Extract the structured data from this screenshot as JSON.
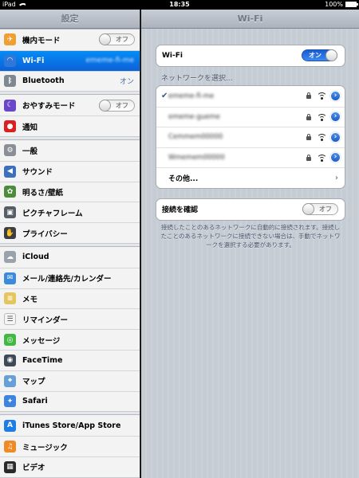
{
  "status_bar": {
    "carrier": "iPad",
    "time": "18:35",
    "battery": "100%"
  },
  "sidebar": {
    "title": "設定",
    "groups": [
      [
        {
          "name": "airplane",
          "label": "機内モード",
          "icon": "airplane-icon",
          "color": "#f0a030",
          "control": "switch-off",
          "switch_label": "オフ"
        },
        {
          "name": "wifi",
          "label": "Wi-Fi",
          "icon": "wifi-icon",
          "color": "#2f77d8",
          "value": "ememe-fi-me",
          "selected": true
        },
        {
          "name": "bluetooth",
          "label": "Bluetooth",
          "icon": "bluetooth-icon",
          "color": "#7f8790",
          "value": "オン"
        }
      ],
      [
        {
          "name": "do-not-disturb",
          "label": "おやすみモード",
          "icon": "moon-icon",
          "color": "#6a46c9",
          "control": "switch-off",
          "switch_label": "オフ"
        },
        {
          "name": "notifications",
          "label": "通知",
          "icon": "notifications-icon",
          "color": "#d92121"
        }
      ],
      [
        {
          "name": "general",
          "label": "一般",
          "icon": "gear-icon",
          "color": "#8a8f97"
        },
        {
          "name": "sounds",
          "label": "サウンド",
          "icon": "speaker-icon",
          "color": "#3e6fbd"
        },
        {
          "name": "brightness",
          "label": "明るさ/壁紙",
          "icon": "flower-icon",
          "color": "#4c8c3a"
        },
        {
          "name": "picture-frame",
          "label": "ピクチャフレーム",
          "icon": "picture-frame-icon",
          "color": "#555d67"
        },
        {
          "name": "privacy",
          "label": "プライバシー",
          "icon": "hand-icon",
          "color": "#3b3f45"
        }
      ],
      [
        {
          "name": "icloud",
          "label": "iCloud",
          "icon": "cloud-icon",
          "color": "#9aa2ac"
        },
        {
          "name": "mail",
          "label": "メール/連絡先/カレンダー",
          "icon": "mail-icon",
          "color": "#3c8ad9"
        },
        {
          "name": "notes",
          "label": "メモ",
          "icon": "notes-icon",
          "color": "#e5c65c"
        },
        {
          "name": "reminders",
          "label": "リマインダー",
          "icon": "list-icon",
          "color": "#f5f5f5"
        },
        {
          "name": "messages",
          "label": "メッセージ",
          "icon": "message-icon",
          "color": "#43b843"
        },
        {
          "name": "facetime",
          "label": "FaceTime",
          "icon": "camera-icon",
          "color": "#3e4a58"
        },
        {
          "name": "maps",
          "label": "マップ",
          "icon": "map-icon",
          "color": "#67a0d6"
        },
        {
          "name": "safari",
          "label": "Safari",
          "icon": "compass-icon",
          "color": "#3c84e0"
        }
      ],
      [
        {
          "name": "itunes",
          "label": "iTunes Store/App Store",
          "icon": "app-store-icon",
          "color": "#1d7ee8"
        },
        {
          "name": "music",
          "label": "ミュージック",
          "icon": "music-icon",
          "color": "#f08a24"
        },
        {
          "name": "videos",
          "label": "ビデオ",
          "icon": "film-icon",
          "color": "#2a2a2a"
        }
      ]
    ]
  },
  "main": {
    "title": "Wi-Fi",
    "wifi_row": {
      "label": "Wi-Fi",
      "switch_label": "オン"
    },
    "network_header": "ネットワークを選択...",
    "networks": [
      {
        "name": "ememe-fi-me",
        "connected": true
      },
      {
        "name": "ememe-gueme",
        "connected": false
      },
      {
        "name": "Cemmem00000",
        "connected": false
      },
      {
        "name": "Wmemem00000",
        "connected": false
      }
    ],
    "other_label": "その他...",
    "ask_row": {
      "label": "接続を確認",
      "switch_label": "オフ"
    },
    "footnote": "接続したことのあるネットワークに自動的に接続されます。接続したことのあるネットワークに接続できない場合は、手動でネットワークを選択する必要があります。"
  }
}
